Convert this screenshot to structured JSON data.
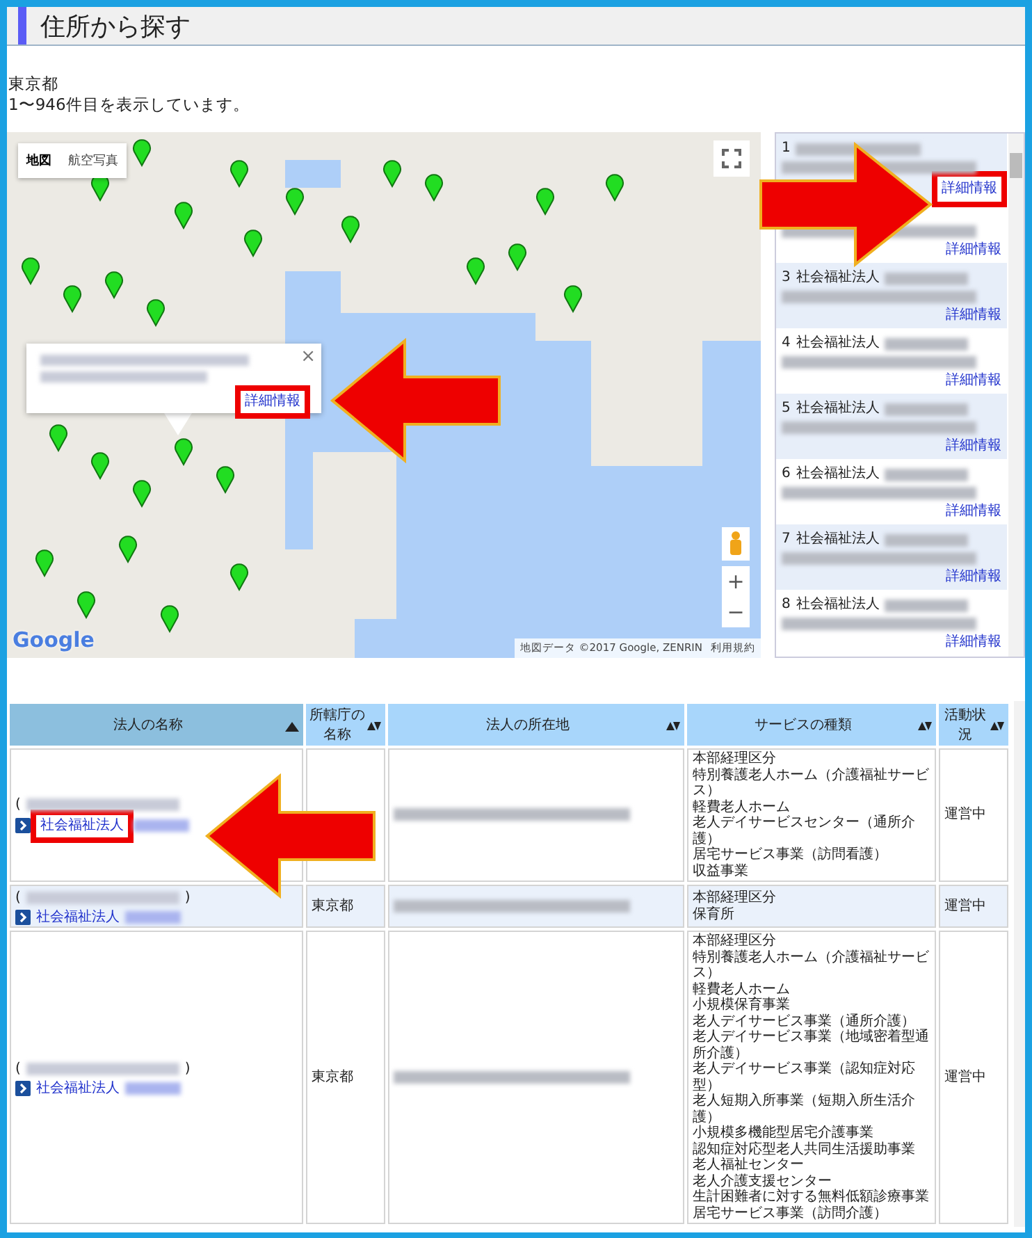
{
  "page_title": "住所から探す",
  "prefecture": "東京都",
  "result_count": "1〜946件目を表示しています。",
  "map": {
    "view_toggle": [
      {
        "label": "地図",
        "selected": true
      },
      {
        "label": "航空写真",
        "selected": false
      }
    ],
    "popup": {
      "link": {
        "label": "詳細情報",
        "highlighted": true
      }
    },
    "close_glyph": "×",
    "zoom_in": "+",
    "zoom_out": "−",
    "logo": "Google",
    "attribution": "地図データ ©2017 Google, ZENRIN",
    "terms": "利用規約"
  },
  "results": [
    {
      "number": "1",
      "link": {
        "label": "詳細情報",
        "highlighted": true
      }
    },
    {
      "link": {
        "label": "詳細情報",
        "highlighted": false
      }
    },
    {
      "number": "3",
      "label": "社会福祉法人",
      "link": {
        "label": "詳細情報",
        "highlighted": false
      }
    },
    {
      "number": "4",
      "label": "社会福祉法人",
      "link": {
        "label": "詳細情報",
        "highlighted": false
      }
    },
    {
      "number": "5",
      "label": "社会福祉法人",
      "link": {
        "label": "詳細情報",
        "highlighted": false
      }
    },
    {
      "number": "6",
      "label": "社会福祉法人",
      "link": {
        "label": "詳細情報",
        "highlighted": false
      }
    },
    {
      "number": "7",
      "label": "社会福祉法人",
      "link": {
        "label": "詳細情報",
        "highlighted": false
      }
    },
    {
      "number": "8",
      "label": "社会福祉法人",
      "link": {
        "label": "詳細情報",
        "highlighted": false
      }
    }
  ],
  "table": {
    "columns": [
      {
        "label": "法人の名称",
        "sorted": true
      },
      {
        "label": "所轄庁の名称",
        "sorted": false
      },
      {
        "label": "法人の所在地",
        "sorted": false
      },
      {
        "label": "サービスの種類",
        "sorted": false
      },
      {
        "label": "活動状況",
        "sorted": false
      }
    ],
    "rows": [
      {
        "open_paren": "(",
        "close_paren": "",
        "corporation": {
          "label": "社会福祉法人",
          "highlighted": true
        },
        "authority": "",
        "services": [
          "本部経理区分",
          "特別養護老人ホーム（介護福祉サービス）",
          "軽費老人ホーム",
          "老人デイサービスセンター（通所介護）",
          "居宅サービス事業（訪問看護）",
          "収益事業"
        ],
        "status": "運営中"
      },
      {
        "open_paren": "(",
        "close_paren": ")",
        "corporation": {
          "label": "社会福祉法人",
          "highlighted": false
        },
        "authority": "東京都",
        "services": [
          "本部経理区分",
          "保育所"
        ],
        "status": "運営中"
      },
      {
        "open_paren": "(",
        "close_paren": ")",
        "corporation": {
          "label": "社会福祉法人",
          "highlighted": false
        },
        "authority": "東京都",
        "services": [
          "本部経理区分",
          "特別養護老人ホーム（介護福祉サービス）",
          "軽費老人ホーム",
          "小規模保育事業",
          "老人デイサービス事業（通所介護）",
          "老人デイサービス事業（地域密着型通所介護）",
          "老人デイサービス事業（認知症対応型）",
          "老人短期入所事業（短期入所生活介護）",
          "小規模多機能型居宅介護事業",
          "認知症対応型老人共同生活援助事業",
          "老人福祉センター",
          "老人介護支援センター",
          "生計困難者に対する無料低額診療事業",
          "居宅サービス事業（訪問介護）"
        ],
        "status": "運営中"
      }
    ]
  },
  "annotations": [
    {
      "kind": "right"
    },
    {
      "kind": "left"
    },
    {
      "kind": "left"
    }
  ]
}
